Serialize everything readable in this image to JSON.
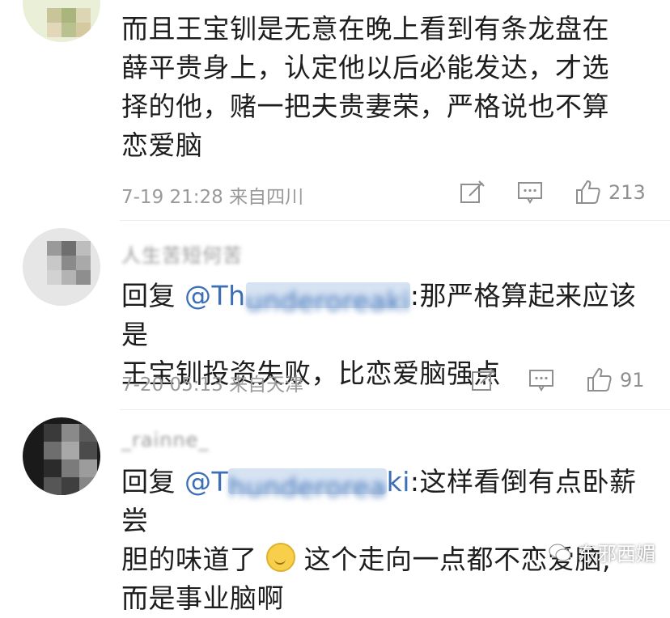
{
  "comments": [
    {
      "text_lines": [
        "而且王宝钏是无意在晚上看到有条龙盘在",
        "薛平贵身上，认定他以后必能发达，才选",
        "择的他，赌一把夫贵妻荣，严格说也不算",
        "恋爱脑"
      ],
      "time": "7-19 21:28",
      "location": "来自四川",
      "likes": "213"
    },
    {
      "username": "人生苦短何苦",
      "reply_prefix": "回复",
      "mention_visible": "@Th",
      "mention_hidden": "underoreaki",
      "line1_rest": ":那严格算起来应该是",
      "line2": "王宝钏投资失败，比恋爱脑强点",
      "time": "7-20 05:13",
      "location": "来自天津",
      "likes": "91"
    },
    {
      "username": "_rainne_",
      "reply_prefix": "回复",
      "mention_visible": "@T",
      "mention_hidden": "hunderorea",
      "mention_tail": "ki",
      "line1_rest": ":这样看倒有点卧薪尝",
      "line2_a": "胆的味道了",
      "line2_b": "这个走向一点都不恋爱脑,",
      "line3": "而是事业脑啊"
    }
  ],
  "watermark": "东邪西媚",
  "icons": [
    "edit-icon",
    "comment-icon",
    "like-icon"
  ]
}
